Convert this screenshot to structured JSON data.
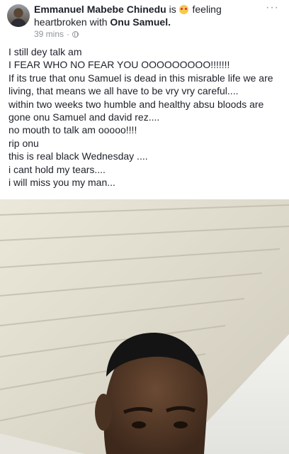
{
  "post": {
    "author": "Emmanuel Mabebe Chinedu",
    "connector_is": "is",
    "feeling_label": "feeling",
    "feeling_text": "heartbroken with",
    "tagged_friend": "Onu Samuel.",
    "time": "39 mins",
    "more_icon": "more-dots-icon",
    "privacy_icon": "globe-icon",
    "lines": [
      "I still dey talk am",
      "I FEAR WHO NO FEAR YOU OOOOOOOOO!!!!!!!",
      "If its true that onu Samuel is dead in this misrable life we are living, that means we all have to be vry vry careful....",
      "within two weeks two humble and healthy absu bloods are gone onu Samuel and david rez....",
      "no mouth to talk am ooooo!!!!",
      "rip onu",
      "this is real black Wednesday ....",
      "i cant hold my tears....",
      "i will miss you my man..."
    ]
  }
}
